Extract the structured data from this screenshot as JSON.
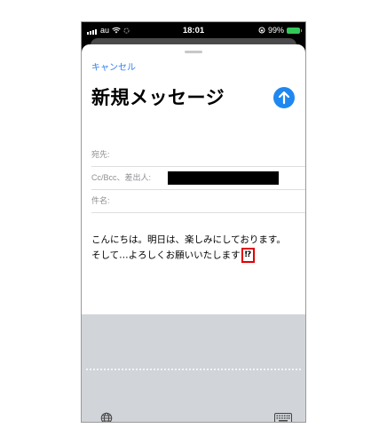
{
  "status_bar": {
    "carrier": "au",
    "time": "18:01",
    "battery": "99%"
  },
  "compose": {
    "cancel_label": "キャンセル",
    "title": "新規メッセージ",
    "to_label": "宛先:",
    "cc_label": "Cc/Bcc、差出人:",
    "subject_label": "件名:",
    "body_line1": "こんにちは。明日は、楽しみにしております。",
    "body_line2": "そして…よろしくお願いいたします",
    "emoji": "⁉"
  },
  "colors": {
    "accent": "#2f7cf6",
    "send_button": "#1e88f0",
    "highlight": "#e10000",
    "keyboard_bg": "#d1d4d9"
  },
  "icons": {
    "send": "arrow-up-icon",
    "globe": "globe-icon",
    "keyboard": "keyboard-icon"
  }
}
